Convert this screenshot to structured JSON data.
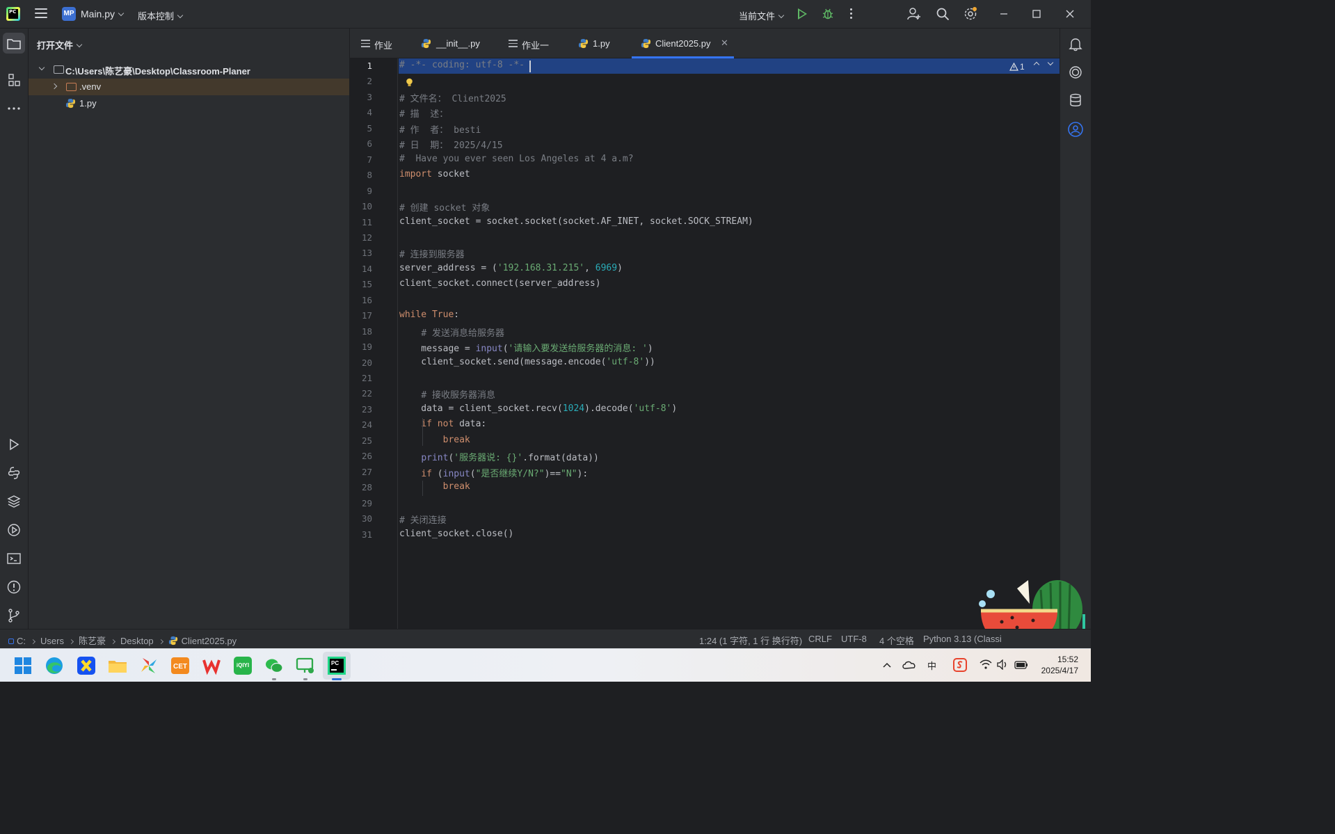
{
  "titlebar": {
    "logo_text": "PC",
    "project_badge": "MP",
    "project_name": "Main.py",
    "vcs_label": "版本控制",
    "run_config": "当前文件"
  },
  "project_panel": {
    "header": "打开文件",
    "tree": [
      {
        "label": "C:\\Users\\陈艺豪\\Desktop\\Classroom-Planer",
        "type": "root"
      },
      {
        "label": ".venv",
        "type": "folder"
      },
      {
        "label": "1.py",
        "type": "python"
      }
    ]
  },
  "tabs": [
    {
      "label": "作业",
      "icon": "lines-icon"
    },
    {
      "label": "__init__.py",
      "icon": "python-icon"
    },
    {
      "label": "作业一",
      "icon": "lines-icon"
    },
    {
      "label": "1.py",
      "icon": "python-icon"
    },
    {
      "label": "Client2025.py",
      "icon": "python-icon",
      "active": true
    }
  ],
  "editor": {
    "inspection_count": "1",
    "line_numbers": [
      "1",
      "2",
      "3",
      "4",
      "5",
      "6",
      "7",
      "8",
      "9",
      "10",
      "11",
      "12",
      "13",
      "14",
      "15",
      "16",
      "17",
      "18",
      "19",
      "20",
      "21",
      "22",
      "23",
      "24",
      "25",
      "26",
      "27",
      "28",
      "29",
      "30",
      "31"
    ],
    "lines": [
      "# -*- coding: utf-8 -*-",
      "",
      "# 文件名： Client2025",
      "# 描  述：",
      "# 作  者： besti",
      "# 日  期： 2025/4/15",
      "#  Have you ever seen Los Angeles at 4 a.m?",
      "import socket",
      "",
      "# 创建 socket 对象",
      "client_socket = socket.socket(socket.AF_INET, socket.SOCK_STREAM)",
      "",
      "# 连接到服务器",
      "server_address = ('192.168.31.215', 6969)",
      "client_socket.connect(server_address)",
      "",
      "while True:",
      "    # 发送消息给服务器",
      "    message = input('请输入要发送给服务器的消息: ')",
      "    client_socket.send(message.encode('utf-8'))",
      "",
      "    # 接收服务器消息",
      "    data = client_socket.recv(1024).decode('utf-8')",
      "    if not data:",
      "        break",
      "    print('服务器说: {}'.format(data))",
      "    if (input(\"是否继续Y/N?\")==\"N\"):",
      "        break",
      "",
      "# 关闭连接",
      "client_socket.close()"
    ]
  },
  "breadcrumb": [
    "C:",
    "Users",
    "陈艺豪",
    "Desktop",
    "Client2025.py"
  ],
  "status": {
    "position": "1:24 (1 字符, 1 行 换行符)",
    "line_sep": "CRLF",
    "encoding": "UTF-8",
    "indent": "4 个空格",
    "interpreter": "Python 3.13 (Classi"
  },
  "taskbar": {
    "time": "15:52",
    "date": "2025/4/17",
    "ime": "中"
  },
  "colors": {
    "accent": "#3574f0",
    "keyword": "#cf8e6d",
    "string": "#6aab73",
    "number": "#2aacb8",
    "comment": "#7a7e85",
    "run_green": "#5fb865"
  }
}
